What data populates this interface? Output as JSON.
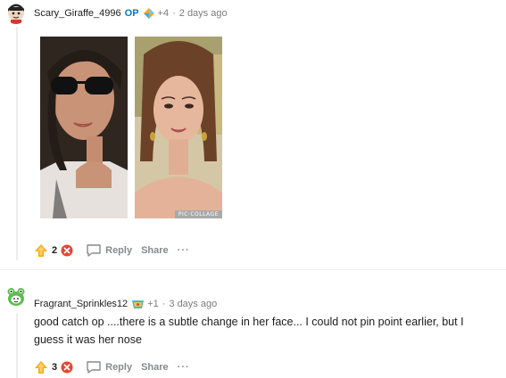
{
  "comments": [
    {
      "username": "Scary_Giraffe_4996",
      "op_badge": "OP",
      "award_count": "+4",
      "separator": "·",
      "time": "2 days ago",
      "image_watermark": "PIC·COLLAGE",
      "score": "2",
      "reply_label": "Reply",
      "share_label": "Share",
      "more_label": "···"
    },
    {
      "username": "Fragrant_Sprinkles12",
      "award_count": "+1",
      "separator": "·",
      "time": "3 days ago",
      "body": "good catch op ....there is a subtle change in her face... I could not pin point earlier, but I guess it was her nose",
      "score": "3",
      "reply_label": "Reply",
      "share_label": "Share",
      "more_label": "···"
    }
  ],
  "colors": {
    "op_blue": "#0079d3",
    "meta_gray": "#7c7c7c",
    "action_gray": "#878a8c",
    "upvote_gold": "#f5a623",
    "downvote_red": "#e8452c"
  }
}
